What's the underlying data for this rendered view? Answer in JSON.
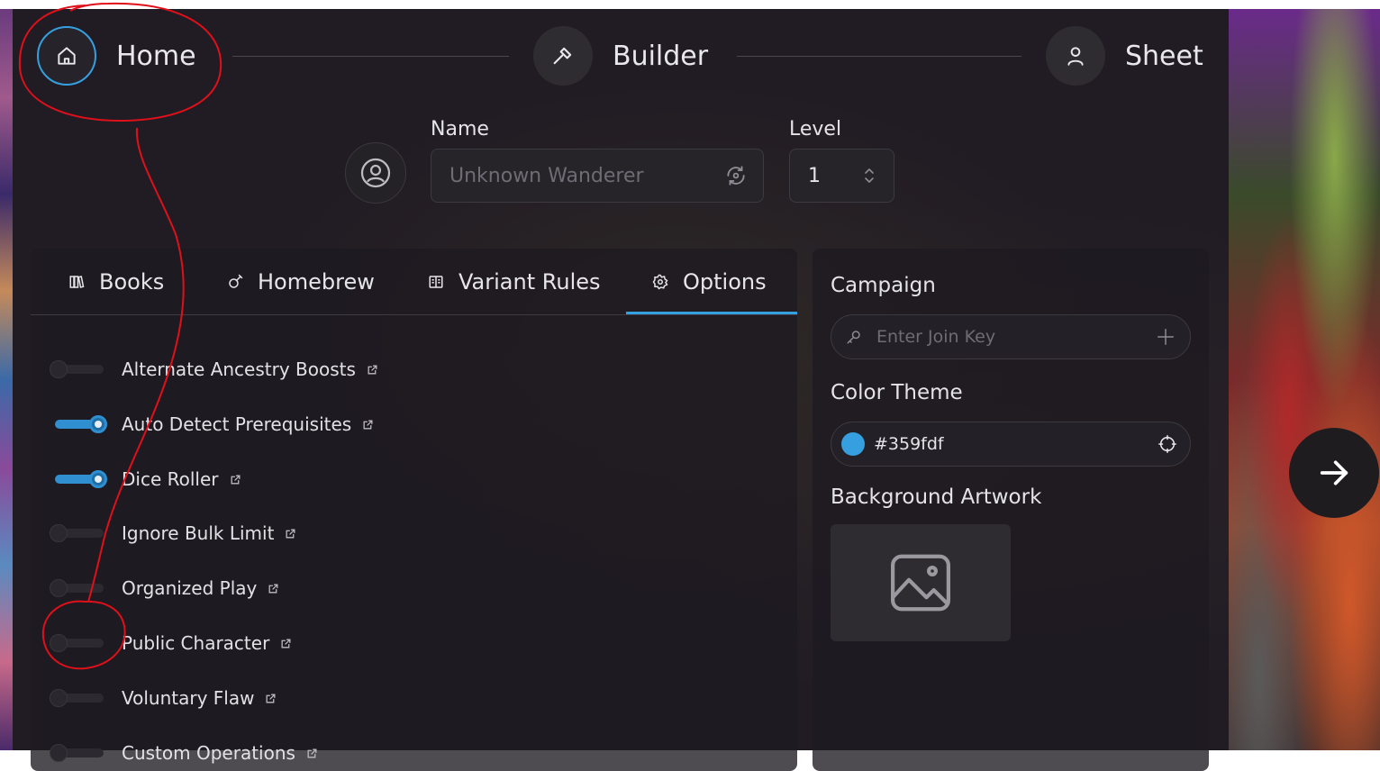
{
  "stepper": {
    "home": "Home",
    "builder": "Builder",
    "sheet": "Sheet"
  },
  "character": {
    "name_label": "Name",
    "name_placeholder": "Unknown Wanderer",
    "level_label": "Level",
    "level_value": "1"
  },
  "tabs": {
    "books": "Books",
    "homebrew": "Homebrew",
    "variant_rules": "Variant Rules",
    "options": "Options",
    "active": "Options"
  },
  "options": [
    {
      "label": "Alternate Ancestry Boosts",
      "enabled": false
    },
    {
      "label": "Auto Detect Prerequisites",
      "enabled": true
    },
    {
      "label": "Dice Roller",
      "enabled": true
    },
    {
      "label": "Ignore Bulk Limit",
      "enabled": false
    },
    {
      "label": "Organized Play",
      "enabled": false
    },
    {
      "label": "Public Character",
      "enabled": false
    },
    {
      "label": "Voluntary Flaw",
      "enabled": false
    },
    {
      "label": "Custom Operations",
      "enabled": false
    }
  ],
  "campaign": {
    "label": "Campaign",
    "placeholder": "Enter Join Key"
  },
  "color_theme": {
    "label": "Color Theme",
    "value": "#359fdf"
  },
  "background_artwork": {
    "label": "Background Artwork"
  },
  "colors": {
    "accent": "#359fdf",
    "annotation": "#e0101a"
  }
}
